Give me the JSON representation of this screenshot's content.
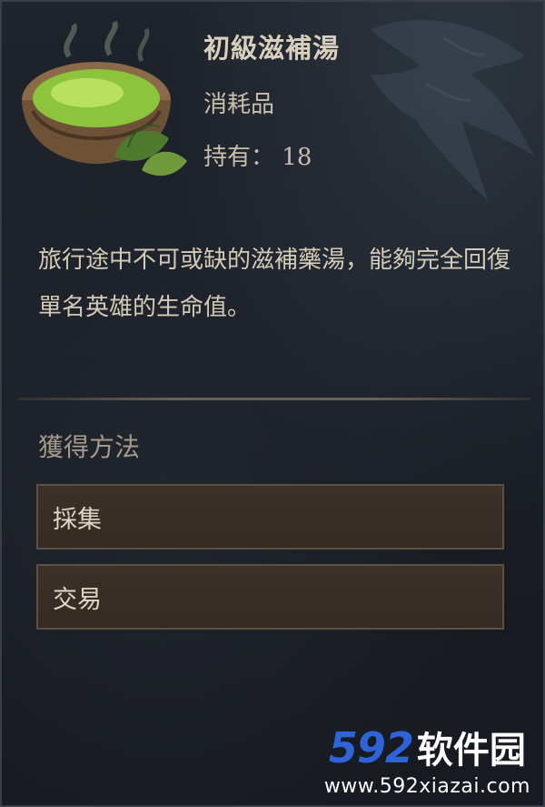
{
  "item": {
    "name": "初級滋補湯",
    "category": "消耗品",
    "held_label": "持有：",
    "held_count": "18",
    "description": "旅行途中不可或缺的滋補藥湯，能夠完全回復單名英雄的生命值。",
    "icon": "green-soup-bowl-icon"
  },
  "acquisition": {
    "title": "獲得方法",
    "sources": [
      {
        "label": "採集"
      },
      {
        "label": "交易"
      }
    ]
  },
  "watermark": {
    "number": "592",
    "text": "软件园",
    "url": "www.592xiazai.com"
  },
  "colors": {
    "background": "#1c2129",
    "text": "#d4cab8",
    "button_bg": "#3a3128",
    "button_border": "#5b5041",
    "watermark_blue": "#2f63d8"
  }
}
